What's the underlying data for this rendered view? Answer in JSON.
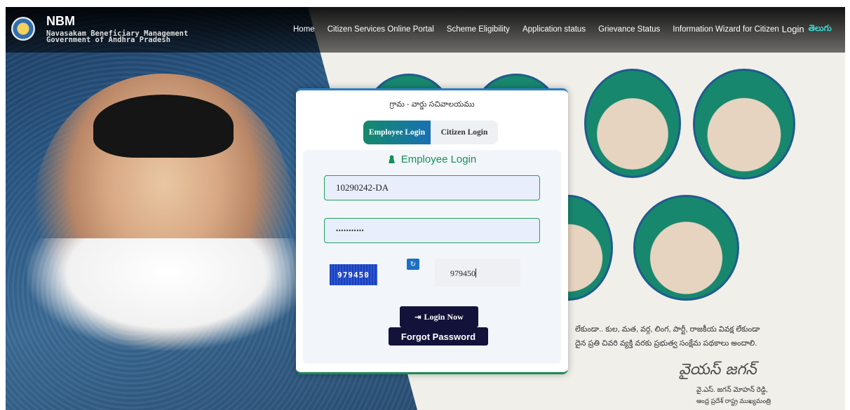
{
  "header": {
    "title": "NBM",
    "subtitle_line1": "Navasakam Beneficiary Management",
    "subtitle_line2": "Government of Andhra Pradesh",
    "nav": [
      {
        "label": "Home"
      },
      {
        "label": "Citizen Services Online Portal"
      },
      {
        "label": "Scheme Eligibility"
      },
      {
        "label": "Application status"
      },
      {
        "label": "Grievance Status"
      },
      {
        "label": "Information Wizard for Citizen"
      },
      {
        "label": "Login"
      },
      {
        "label": "తెలుగు"
      }
    ]
  },
  "card": {
    "title": "గ్రామ - వార్డు సచివాలయము",
    "tabs": [
      {
        "label": "Employee Login",
        "active": true
      },
      {
        "label": "Citizen Login",
        "active": false
      }
    ],
    "panel_title": "Employee Login",
    "username_value": "10290242-DA",
    "password_value": "•••••••••••",
    "captcha_text": "979450",
    "captcha_input_value": "979450",
    "login_button": "Login Now",
    "forgot_button": "Forgot Password"
  },
  "background": {
    "tagline_line1": "లేకుండా.. కుల, మత, వర్గ, లింగ, పార్టీ, రాజకీయ వివక్ష లేకుండా",
    "tagline_line2": "దైన ప్రతి చివరి వ్యక్తి వరకు ప్రభుత్వ సంక్షేమ పథకాలు అందాలి.",
    "signature": "వైయస్ జగన్",
    "sign_name": "వై.ఎస్. జగన్ మోహన్ రెడ్డి,",
    "sign_role": "ఆంధ్ర ప్రదేశ్ రాష్ట్ర ముఖ్యమంత్రి"
  },
  "colors": {
    "accent_green": "#169055",
    "tab_gradient_start": "#158a6a",
    "tab_gradient_end": "#1970b4",
    "button_dark": "#12123a",
    "nav_telugu": "#3ad6d0"
  }
}
